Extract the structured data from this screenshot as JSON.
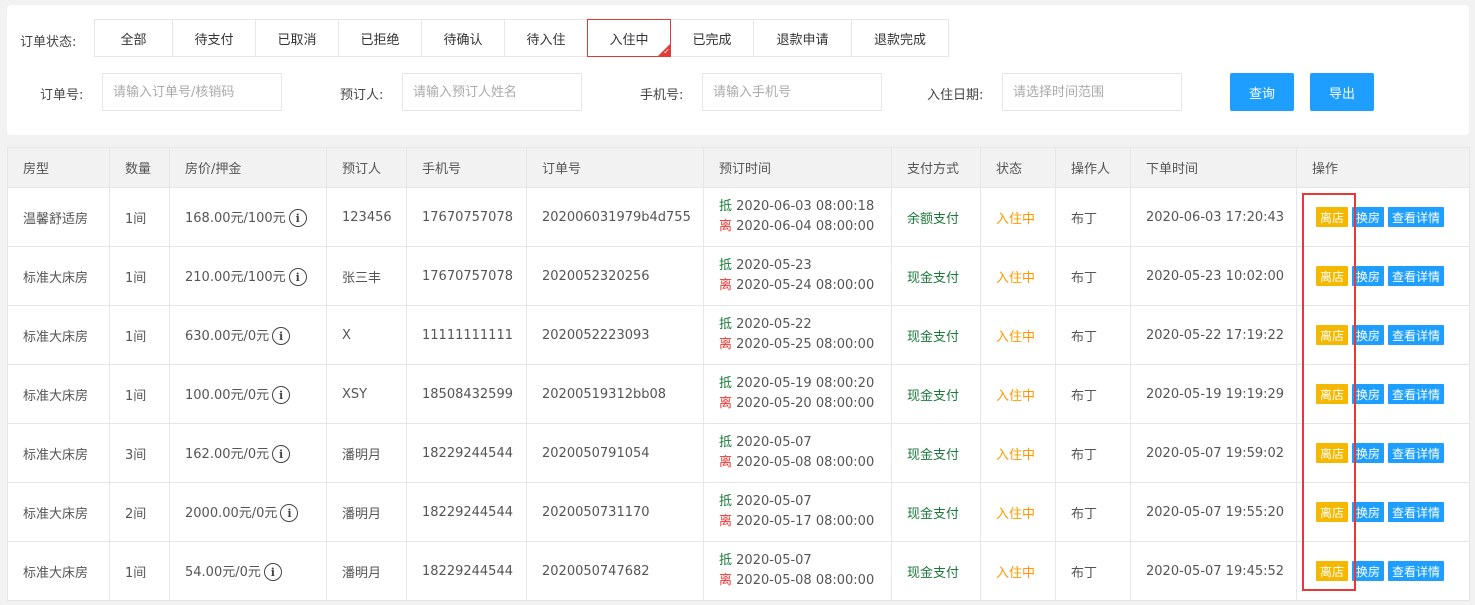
{
  "filters": {
    "status_label": "订单状态:",
    "status_tabs": [
      {
        "label": "全部",
        "active": false
      },
      {
        "label": "待支付",
        "active": false
      },
      {
        "label": "已取消",
        "active": false
      },
      {
        "label": "已拒绝",
        "active": false
      },
      {
        "label": "待确认",
        "active": false
      },
      {
        "label": "待入住",
        "active": false
      },
      {
        "label": "入住中",
        "active": true
      },
      {
        "label": "已完成",
        "active": false
      },
      {
        "label": "退款申请",
        "active": false
      },
      {
        "label": "退款完成",
        "active": false
      }
    ],
    "order_no_label": "订单号:",
    "order_no_placeholder": "请输入订单号/核销码",
    "booker_label": "预订人:",
    "booker_placeholder": "请输入预订人姓名",
    "phone_label": "手机号:",
    "phone_placeholder": "请输入手机号",
    "checkin_label": "入住日期:",
    "checkin_placeholder": "请选择时间范围",
    "query_button": "查询",
    "export_button": "导出"
  },
  "table": {
    "headers": [
      "房型",
      "数量",
      "房价/押金",
      "预订人",
      "手机号",
      "订单号",
      "预订时间",
      "支付方式",
      "状态",
      "操作人",
      "下单时间",
      "操作"
    ],
    "in_tag": "抵",
    "out_tag": "离",
    "info_glyph": "i",
    "actions": {
      "leave": "离店",
      "swap": "换房",
      "detail": "查看详情"
    },
    "rows": [
      {
        "room_type": "温馨舒适房",
        "qty": "1间",
        "price": "168.00元/100元",
        "booker": "123456",
        "phone": "17670757078",
        "order_no": "202006031979b4d755",
        "checkin": "2020-06-03 08:00:18",
        "checkout": "2020-06-04 08:00:00",
        "payment": "余额支付",
        "status": "入住中",
        "operator": "布丁",
        "order_time": "2020-06-03 17:20:43"
      },
      {
        "room_type": "标准大床房",
        "qty": "1间",
        "price": "210.00元/100元",
        "booker": "张三丰",
        "phone": "17670757078",
        "order_no": "2020052320256",
        "checkin": "2020-05-23",
        "checkout": "2020-05-24 08:00:00",
        "payment": "现金支付",
        "status": "入住中",
        "operator": "布丁",
        "order_time": "2020-05-23 10:02:00"
      },
      {
        "room_type": "标准大床房",
        "qty": "1间",
        "price": "630.00元/0元",
        "booker": "X",
        "phone": "11111111111",
        "order_no": "2020052223093",
        "checkin": "2020-05-22",
        "checkout": "2020-05-25 08:00:00",
        "payment": "现金支付",
        "status": "入住中",
        "operator": "布丁",
        "order_time": "2020-05-22 17:19:22"
      },
      {
        "room_type": "标准大床房",
        "qty": "1间",
        "price": "100.00元/0元",
        "booker": "XSY",
        "phone": "18508432599",
        "order_no": "20200519312bb08",
        "checkin": "2020-05-19 08:00:20",
        "checkout": "2020-05-20 08:00:00",
        "payment": "现金支付",
        "status": "入住中",
        "operator": "布丁",
        "order_time": "2020-05-19 19:19:29"
      },
      {
        "room_type": "标准大床房",
        "qty": "3间",
        "price": "162.00元/0元",
        "booker": "潘明月",
        "phone": "18229244544",
        "order_no": "2020050791054",
        "checkin": "2020-05-07",
        "checkout": "2020-05-08 08:00:00",
        "payment": "现金支付",
        "status": "入住中",
        "operator": "布丁",
        "order_time": "2020-05-07 19:59:02"
      },
      {
        "room_type": "标准大床房",
        "qty": "2间",
        "price": "2000.00元/0元",
        "booker": "潘明月",
        "phone": "18229244544",
        "order_no": "2020050731170",
        "checkin": "2020-05-07",
        "checkout": "2020-05-17 08:00:00",
        "payment": "现金支付",
        "status": "入住中",
        "operator": "布丁",
        "order_time": "2020-05-07 19:55:20"
      },
      {
        "room_type": "标准大床房",
        "qty": "1间",
        "price": "54.00元/0元",
        "booker": "潘明月",
        "phone": "18229244544",
        "order_no": "2020050747682",
        "checkin": "2020-05-07",
        "checkout": "2020-05-08 08:00:00",
        "payment": "现金支付",
        "status": "入住中",
        "operator": "布丁",
        "order_time": "2020-05-07 19:45:52"
      }
    ]
  },
  "colors": {
    "accent": "#1e9fff",
    "active_tab_border": "#e53935",
    "status_in": "#ff9800",
    "leave_button": "#f5b800",
    "highlight_box": "#e53935"
  }
}
